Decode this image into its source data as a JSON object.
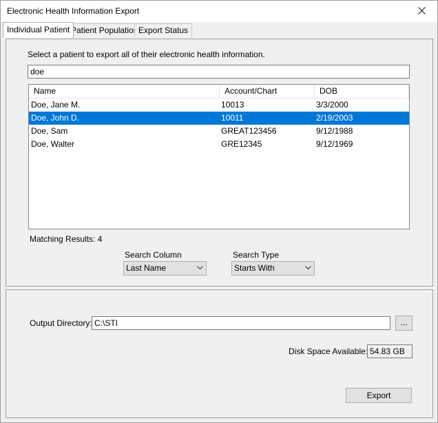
{
  "window": {
    "title": "Electronic Health Information Export"
  },
  "tabs": [
    {
      "label": "Individual Patient"
    },
    {
      "label": "Patient Population"
    },
    {
      "label": "Export Status"
    }
  ],
  "search": {
    "instruction": "Select a patient to export all of their electronic health information.",
    "value": "doe"
  },
  "patients": {
    "columns": [
      "Name",
      "Account/Chart",
      "DOB"
    ],
    "rows": [
      {
        "name": "Doe, Jane M.",
        "account": "10013",
        "dob": "3/3/2000",
        "selected": false
      },
      {
        "name": "Doe, John D.",
        "account": "10011",
        "dob": "2/19/2003",
        "selected": true
      },
      {
        "name": "Doe, Sam",
        "account": "GREAT123456",
        "dob": "9/12/1988",
        "selected": false
      },
      {
        "name": "Doe, Walter",
        "account": "GRE12345",
        "dob": "9/12/1969",
        "selected": false
      }
    ],
    "matching_results": "Matching Results: 4"
  },
  "filters": {
    "search_column_label": "Search Column",
    "search_column_value": "Last Name",
    "search_type_label": "Search Type",
    "search_type_value": "Starts With"
  },
  "export": {
    "output_directory_label": "Output Directory:",
    "output_directory_value": "C:\\STI",
    "browse_label": "...",
    "disk_space_label": "Disk Space Available:",
    "disk_space_value": "54.83 GB",
    "export_button": "Export"
  }
}
